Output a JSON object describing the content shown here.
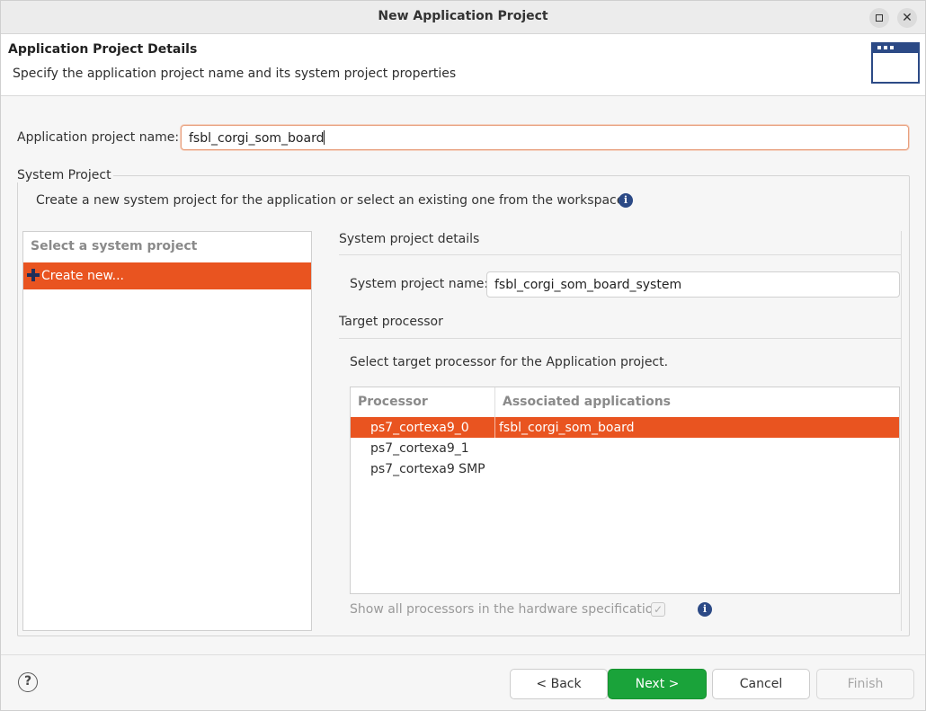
{
  "window": {
    "title": "New Application Project"
  },
  "header": {
    "title": "Application Project Details",
    "description": "Specify the application project name and its system project properties",
    "icon": "wizard-window-icon"
  },
  "project_name": {
    "label": "Application project name:",
    "value": "fsbl_corgi_som_board"
  },
  "system_project": {
    "legend": "System Project",
    "description": "Create a new system project for the application or select an existing one from the workspace",
    "list_header": "Select a system project",
    "list_items": [
      {
        "label": "Create new...",
        "icon": "plus-icon",
        "selected": true
      }
    ],
    "details": {
      "title": "System project details",
      "name_label": "System project name:",
      "name_value": "fsbl_corgi_som_board_system"
    },
    "target": {
      "title": "Target processor",
      "description": "Select target processor for the Application project.",
      "columns": [
        "Processor",
        "Associated applications"
      ],
      "rows": [
        {
          "processor": "ps7_cortexa9_0",
          "applications": "fsbl_corgi_som_board",
          "selected": true
        },
        {
          "processor": "ps7_cortexa9_1",
          "applications": "",
          "selected": false
        },
        {
          "processor": "ps7_cortexa9 SMP",
          "applications": "",
          "selected": false
        }
      ],
      "show_all_label": "Show all processors in the hardware specification",
      "show_all_checked": true
    }
  },
  "footer": {
    "back_label": "< Back",
    "next_label": "Next >",
    "cancel_label": "Cancel",
    "finish_label": "Finish"
  },
  "colors": {
    "selection": "#e95420",
    "primary_button": "#1aa33a",
    "info_icon": "#2c4a86"
  }
}
